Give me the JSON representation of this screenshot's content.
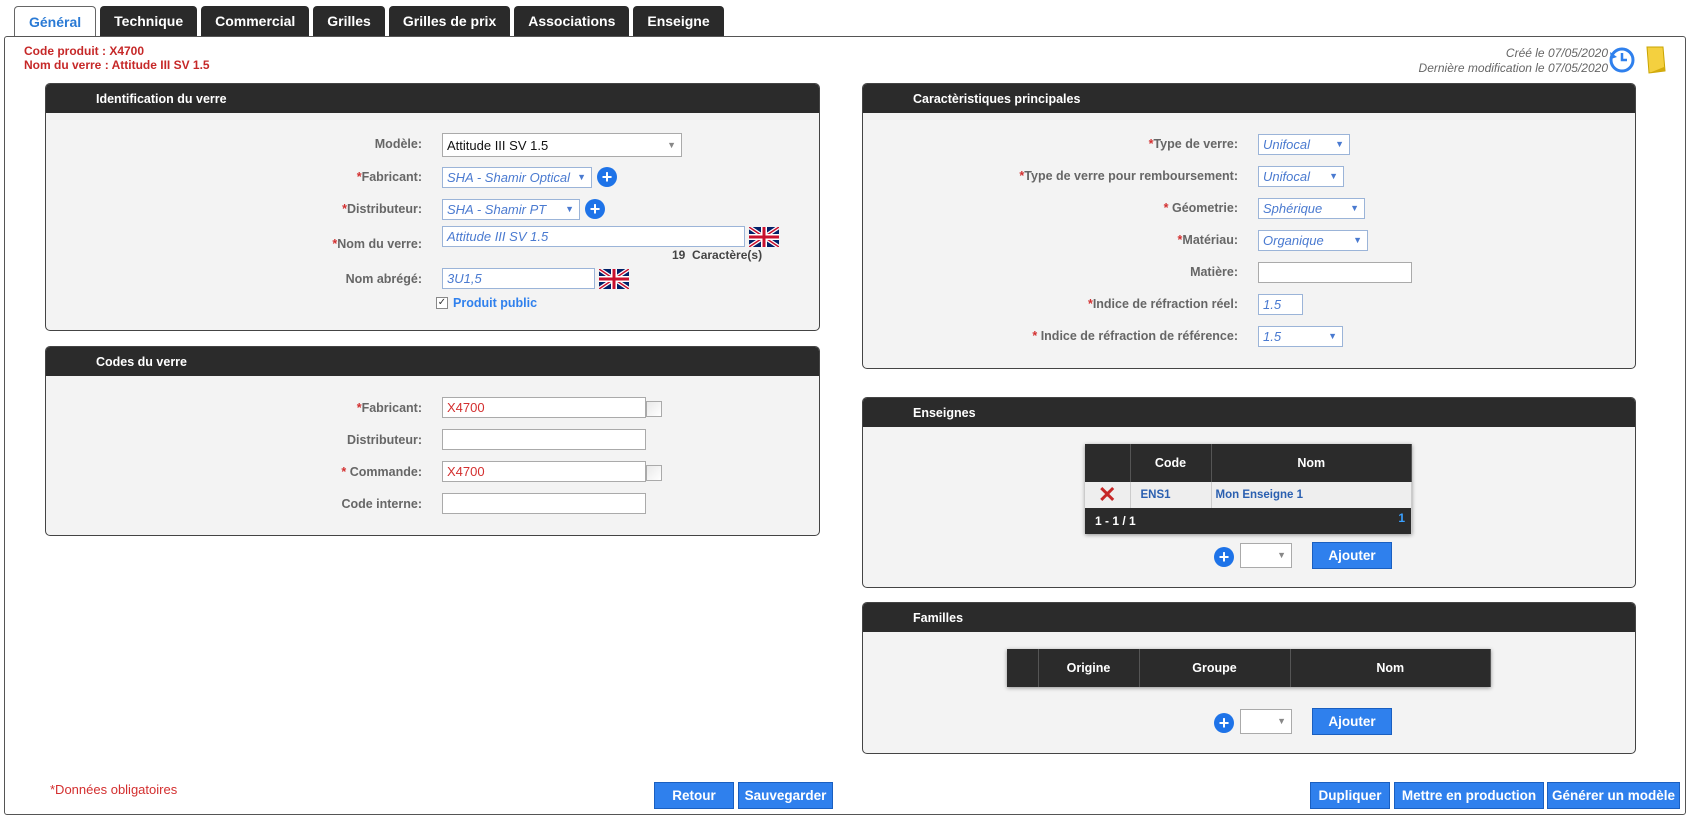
{
  "tabs": [
    "Général",
    "Technique",
    "Commercial",
    "Grilles",
    "Grilles de prix",
    "Associations",
    "Enseigne"
  ],
  "header": {
    "code_produit": "Code produit : X4700",
    "nom_verre": "Nom du verre : Attitude III SV 1.5",
    "cree": "Créé le 07/05/2020",
    "modif": "Dernière modification le 07/05/2020"
  },
  "identification": {
    "title": "Identification du verre",
    "modele_label": "Modèle:",
    "modele_value": "Attitude III SV 1.5",
    "fabricant_label": "Fabricant:",
    "fabricant_value": "SHA - Shamir Optical",
    "distributeur_label": "Distributeur:",
    "distributeur_value": "SHA - Shamir PT",
    "nom_label": "Nom du verre:",
    "nom_value": "Attitude III SV 1.5",
    "char_count": "19",
    "char_label": "Caractère(s)",
    "abrege_label": "Nom abrégé:",
    "abrege_value": "3U1,5",
    "public_label": "Produit public"
  },
  "codes": {
    "title": "Codes du verre",
    "fabricant_label": "Fabricant:",
    "fabricant_value": "X4700",
    "distributeur_label": "Distributeur:",
    "distributeur_value": "",
    "commande_label": "Commande:",
    "commande_value": "X4700",
    "interne_label": "Code interne:",
    "interne_value": ""
  },
  "caracteristiques": {
    "title": "Caractèristiques principales",
    "type_label": "Type de verre:",
    "type_value": "Unifocal",
    "remb_label": "Type de verre pour remboursement:",
    "remb_value": "Unifocal",
    "geo_label": "Géometrie:",
    "geo_value": "Sphérique",
    "mat_label": "Matériau:",
    "mat_value": "Organique",
    "matiere_label": "Matière:",
    "matiere_value": "",
    "indice_reel_label": "Indice de réfraction réel:",
    "indice_reel_value": "1.5",
    "indice_ref_label": "Indice de réfraction de référence:",
    "indice_ref_value": "1.5"
  },
  "enseignes": {
    "title": "Enseignes",
    "col_code": "Code",
    "col_nom": "Nom",
    "row_code": "ENS1",
    "row_nom": "Mon Enseigne 1",
    "pager": "1 - 1 / 1",
    "page": "1",
    "add_label": "Ajouter"
  },
  "familles": {
    "title": "Familles",
    "col_origine": "Origine",
    "col_groupe": "Groupe",
    "col_nom": "Nom",
    "add_label": "Ajouter"
  },
  "footer": {
    "mandatory": "*Données obligatoires",
    "retour": "Retour",
    "sauvegarder": "Sauvegarder",
    "dupliquer": "Dupliquer",
    "production": "Mettre en production",
    "modele": "Générer un modèle"
  },
  "colors": {
    "accent": "#2f80ed",
    "required": "#d32f2f",
    "header": "#2b2b2b"
  }
}
